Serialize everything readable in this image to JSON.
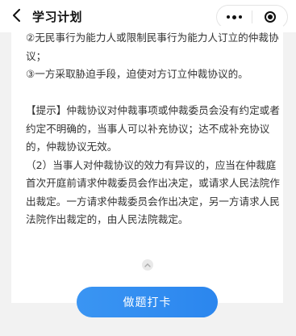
{
  "navbar": {
    "title": "学习计划",
    "back_icon": "chevron-left-icon",
    "more_icon": "more-dots-icon",
    "close_icon": "target-circle-icon"
  },
  "content": {
    "lines": [
      "②无民事行为能力人或限制民事行为能力人订立的仲裁协议；",
      "③一方采取胁迫手段，迫使对方订立仲裁协议的。",
      "",
      "【提示】仲裁协议对仲裁事项或仲裁委员会没有约定或者约定不明确的，当事人可以补充协议；达不成补充协议的，仲裁协议无效。",
      "（2）当事人对仲裁协议的效力有异议的，应当在仲裁庭首次开庭前请求仲裁委员会作出决定，或请求人民法院作出裁定。一方请求仲裁委员会作出决定，另一方请求人民法院作出裁定的，由人民法院裁定。"
    ]
  },
  "collapse_icon": "chevron-up-icon",
  "checkin_button": {
    "label": "做题打卡"
  },
  "colors": {
    "accent": "#2b86ee",
    "background": "#f2f2f2"
  }
}
